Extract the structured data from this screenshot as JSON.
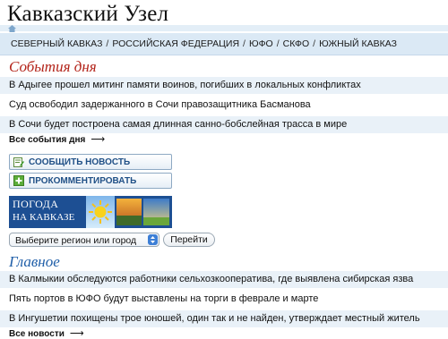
{
  "site": {
    "title": "Кавказский Узел"
  },
  "regions": [
    "СЕВЕРНЫЙ КАВКАЗ",
    "РОССИЙСКАЯ ФЕДЕРАЦИЯ",
    "ЮФО",
    "СКФО",
    "ЮЖНЫЙ КАВКАЗ"
  ],
  "events": {
    "title": "События дня",
    "items": [
      "В Адыгее прошел митинг памяти воинов, погибших в локальных конфликтах",
      "Суд освободил задержанного в Сочи правозащитника Басманова",
      "В Сочи будет построена самая длинная санно-бобслейная трасса в мире"
    ],
    "all_label": "Все события дня",
    "arrow": "⟶"
  },
  "actions": {
    "report_news": "СООБЩИТЬ НОВОСТЬ",
    "comment": "ПРОКОММЕНТИРОВАТЬ"
  },
  "weather": {
    "line1": "ПОГОДА",
    "line2": "НА КАВКАЗЕ",
    "select_value": "Выберите регион или город",
    "go_label": "Перейти"
  },
  "main": {
    "title": "Главное",
    "items": [
      "В Калмыкии обследуются работники сельхозкооператива, где выявлена сибирская язва",
      "Пять портов в ЮФО будут выставлены на торги в феврале и марте",
      "В Ингушетии похищены трое юношей, один так и не найден, утверждает местный житель"
    ],
    "all_label": "Все новости",
    "arrow": "⟶"
  },
  "colors": {
    "section_red": "#b3241a",
    "section_blue": "#1f5ea8",
    "nav_background": "#dbe9f5",
    "row_shade": "#e9f1f8",
    "weather_banner": "#1d4f93"
  },
  "icons": [
    "home-icon",
    "edit-note-icon",
    "add-comment-icon",
    "sun-icon",
    "select-arrows-icon"
  ]
}
